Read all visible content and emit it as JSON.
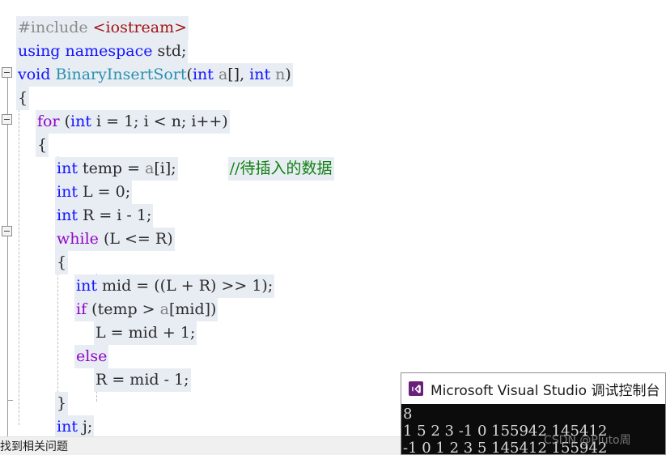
{
  "editor": {
    "comment_line": "//待插入的数据",
    "lines": [
      {
        "indent": 0,
        "tokens": [
          {
            "t": "#include ",
            "c": "tk-pre"
          },
          {
            "t": "<iostream>",
            "c": "tk-str"
          }
        ]
      },
      {
        "indent": 0,
        "tokens": [
          {
            "t": "using namespace ",
            "c": "tk-kw"
          },
          {
            "t": "std;",
            "c": "tk-id"
          }
        ]
      },
      {
        "indent": 0,
        "tokens": [
          {
            "t": "void ",
            "c": "tk-kw"
          },
          {
            "t": "BinaryInsertSort",
            "c": "tk-type"
          },
          {
            "t": "(",
            "c": "tk-punc"
          },
          {
            "t": "int ",
            "c": "tk-kw"
          },
          {
            "t": "a",
            "c": "tk-var"
          },
          {
            "t": "[], ",
            "c": "tk-punc"
          },
          {
            "t": "int ",
            "c": "tk-kw"
          },
          {
            "t": "n",
            "c": "tk-var"
          },
          {
            "t": ")",
            "c": "tk-punc"
          }
        ]
      },
      {
        "indent": 0,
        "tokens": [
          {
            "t": "{",
            "c": "tk-punc"
          }
        ]
      },
      {
        "indent": 1,
        "tokens": [
          {
            "t": "for ",
            "c": "tk-ctl"
          },
          {
            "t": "(",
            "c": "tk-punc"
          },
          {
            "t": "int ",
            "c": "tk-kw"
          },
          {
            "t": "i = 1; i ",
            "c": "tk-id"
          },
          {
            "t": "<",
            "c": "tk-punc"
          },
          {
            "t": " n; i++)",
            "c": "tk-id"
          }
        ]
      },
      {
        "indent": 1,
        "tokens": [
          {
            "t": "{",
            "c": "tk-punc"
          }
        ]
      },
      {
        "indent": 2,
        "tokens": [
          {
            "t": "int ",
            "c": "tk-kw"
          },
          {
            "t": "temp = ",
            "c": "tk-id"
          },
          {
            "t": "a",
            "c": "tk-var"
          },
          {
            "t": "[i];",
            "c": "tk-id"
          }
        ]
      },
      {
        "indent": 2,
        "tokens": [
          {
            "t": "int ",
            "c": "tk-kw"
          },
          {
            "t": "L = 0;",
            "c": "tk-id"
          }
        ]
      },
      {
        "indent": 2,
        "tokens": [
          {
            "t": "int ",
            "c": "tk-kw"
          },
          {
            "t": "R = i - 1;",
            "c": "tk-id"
          }
        ]
      },
      {
        "indent": 2,
        "tokens": [
          {
            "t": "while ",
            "c": "tk-ctl"
          },
          {
            "t": "(L <= R)",
            "c": "tk-id"
          }
        ]
      },
      {
        "indent": 2,
        "tokens": [
          {
            "t": "{",
            "c": "tk-punc"
          }
        ]
      },
      {
        "indent": 3,
        "tokens": [
          {
            "t": "int ",
            "c": "tk-kw"
          },
          {
            "t": "mid = ((L + R) >> 1);",
            "c": "tk-id"
          }
        ]
      },
      {
        "indent": 3,
        "tokens": [
          {
            "t": "if ",
            "c": "tk-ctl"
          },
          {
            "t": "(temp > ",
            "c": "tk-id"
          },
          {
            "t": "a",
            "c": "tk-var"
          },
          {
            "t": "[mid])",
            "c": "tk-id"
          }
        ]
      },
      {
        "indent": 4,
        "tokens": [
          {
            "t": "L = mid + 1;",
            "c": "tk-id"
          }
        ]
      },
      {
        "indent": 3,
        "tokens": [
          {
            "t": "else",
            "c": "tk-ctl"
          }
        ]
      },
      {
        "indent": 4,
        "tokens": [
          {
            "t": "R = mid - 1;",
            "c": "tk-id"
          }
        ]
      },
      {
        "indent": 2,
        "tokens": [
          {
            "t": "}",
            "c": "tk-punc"
          }
        ]
      },
      {
        "indent": 2,
        "tokens": [
          {
            "t": "int ",
            "c": "tk-kw"
          },
          {
            "t": "j;",
            "c": "tk-id"
          }
        ]
      }
    ]
  },
  "statusbar": {
    "text": "找到相关问题"
  },
  "console": {
    "title": "Microsoft Visual Studio 调试控制台",
    "icon": "visual-studio-icon",
    "output": [
      "8",
      "1 5 2 3 -1 0 155942 145412",
      "-1 0 1 2 3 5 145412 155942"
    ]
  },
  "watermark": {
    "text": "CSDN @Pluto周"
  },
  "colors": {
    "selection": "#e8edf4",
    "keyword": "#1414ff",
    "control": "#8f08c4",
    "type": "#2b91af",
    "comment": "#108010",
    "string": "#a31515",
    "preprocessor": "#8c8c8c",
    "console_bg": "#0c0c0c",
    "vs_icon": "#68217a"
  }
}
